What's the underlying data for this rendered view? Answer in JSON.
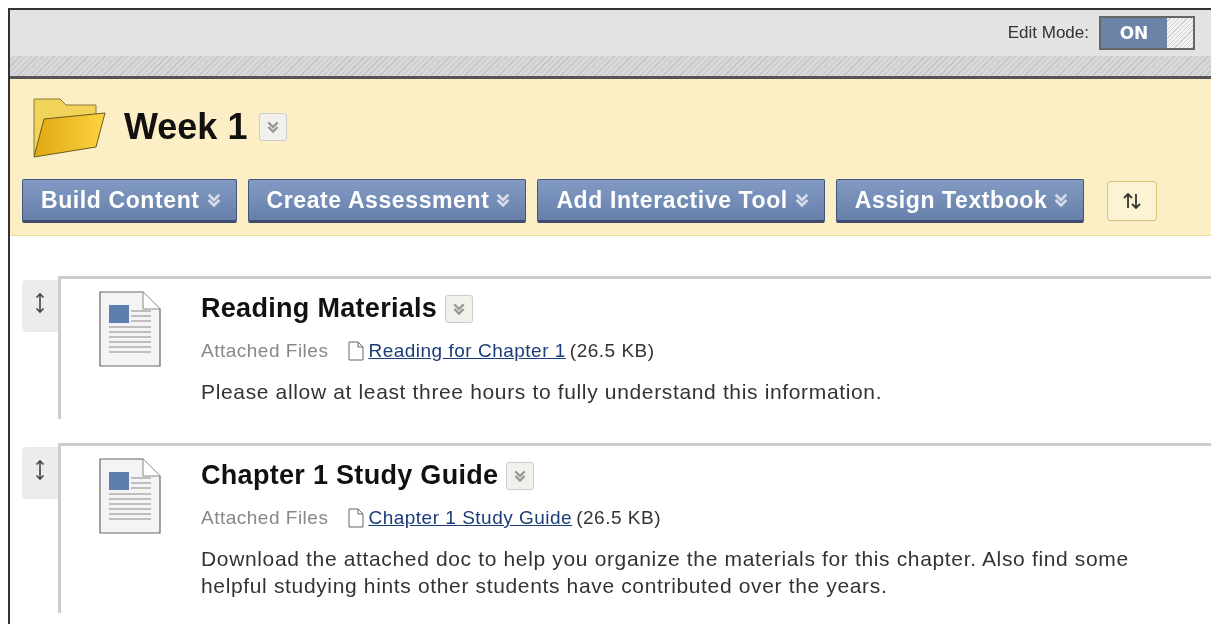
{
  "edit_mode": {
    "label": "Edit Mode:",
    "value": "ON",
    "on": true
  },
  "folder": {
    "title": "Week 1"
  },
  "action_buttons": [
    {
      "label": "Build Content"
    },
    {
      "label": "Create Assessment"
    },
    {
      "label": "Add Interactive Tool"
    },
    {
      "label": "Assign Textbook"
    }
  ],
  "items": [
    {
      "title": "Reading Materials",
      "files_label": "Attached Files",
      "file_name": "Reading for Chapter 1",
      "file_size": "(26.5 KB)",
      "description": "Please allow at least three hours to fully understand this information."
    },
    {
      "title": "Chapter 1 Study Guide",
      "files_label": "Attached Files",
      "file_name": "Chapter 1 Study Guide",
      "file_size": "(26.5 KB)",
      "description": "Download the attached doc to help you organize the materials for this chapter. Also find some helpful studying hints other students have contributed over the years."
    }
  ]
}
